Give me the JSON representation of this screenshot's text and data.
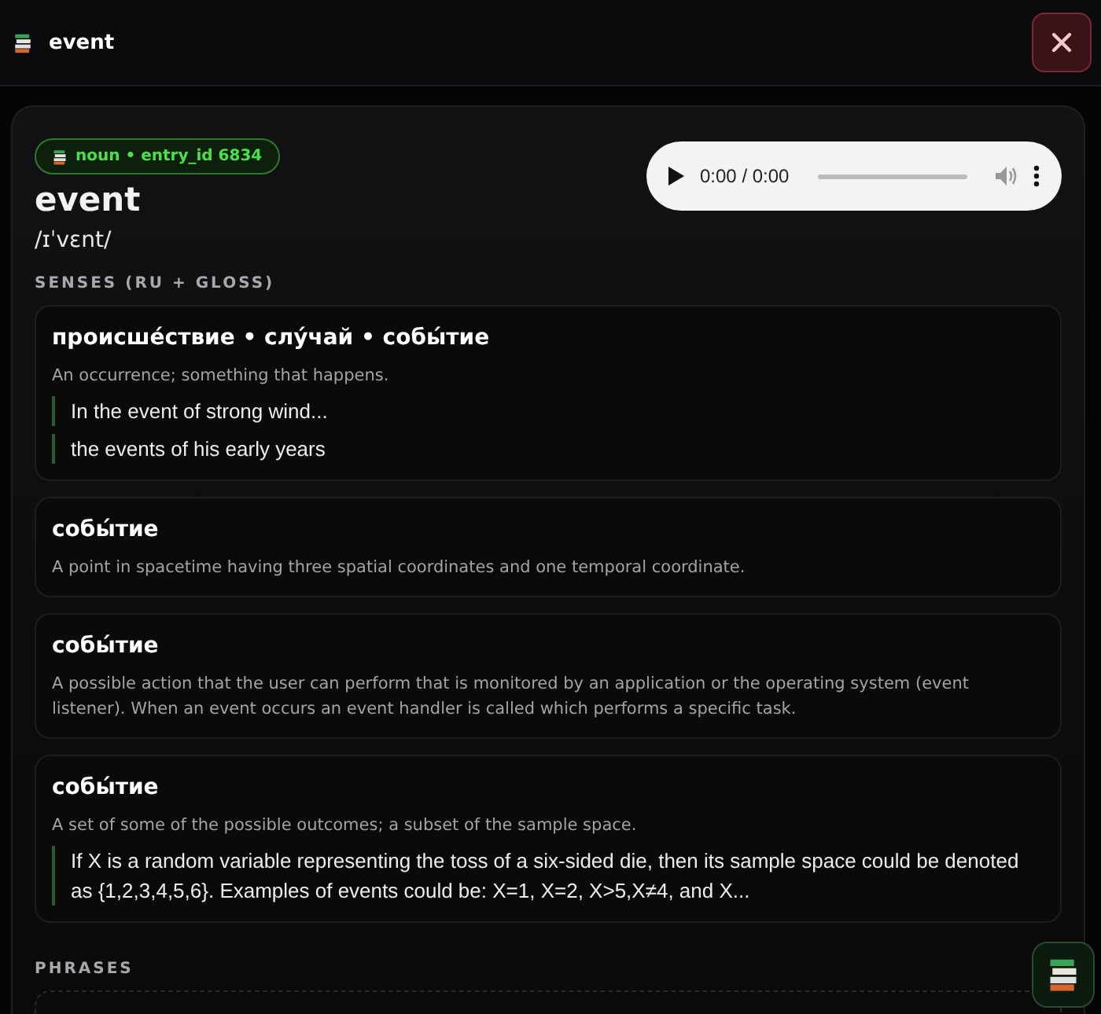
{
  "header": {
    "title": "event"
  },
  "entry": {
    "badge": "noun • entry_id 6834",
    "word": "event",
    "ipa": "/ɪˈvɛnt/",
    "audio": {
      "time": "0:00 / 0:00"
    }
  },
  "senses_heading": "SENSES (RU + GLOSS)",
  "senses": [
    {
      "headword": "происше́ствие • слу́чай • собы́тие",
      "gloss": "An occurrence; something that happens.",
      "examples": [
        "In the event of strong wind...",
        "the events of his early years"
      ]
    },
    {
      "headword": "собы́тие",
      "gloss": "A point in spacetime having three spatial coordinates and one temporal coordinate."
    },
    {
      "headword": "собы́тие",
      "gloss": "A possible action that the user can perform that is monitored by an application or the operating system (event listener). When an event occurs an event handler is called which performs a specific task."
    },
    {
      "headword": "собы́тие",
      "gloss": "A set of some of the possible outcomes; a subset of the sample space.",
      "examples": [
        "If X is a random variable representing the toss of a six-sided die, then its sample space could be denoted as {1,2,3,4,5,6}. Examples of events could be: X=1, X=2, X>5,X≠4, and X..."
      ]
    }
  ],
  "phrases_heading": "PHRASES"
}
